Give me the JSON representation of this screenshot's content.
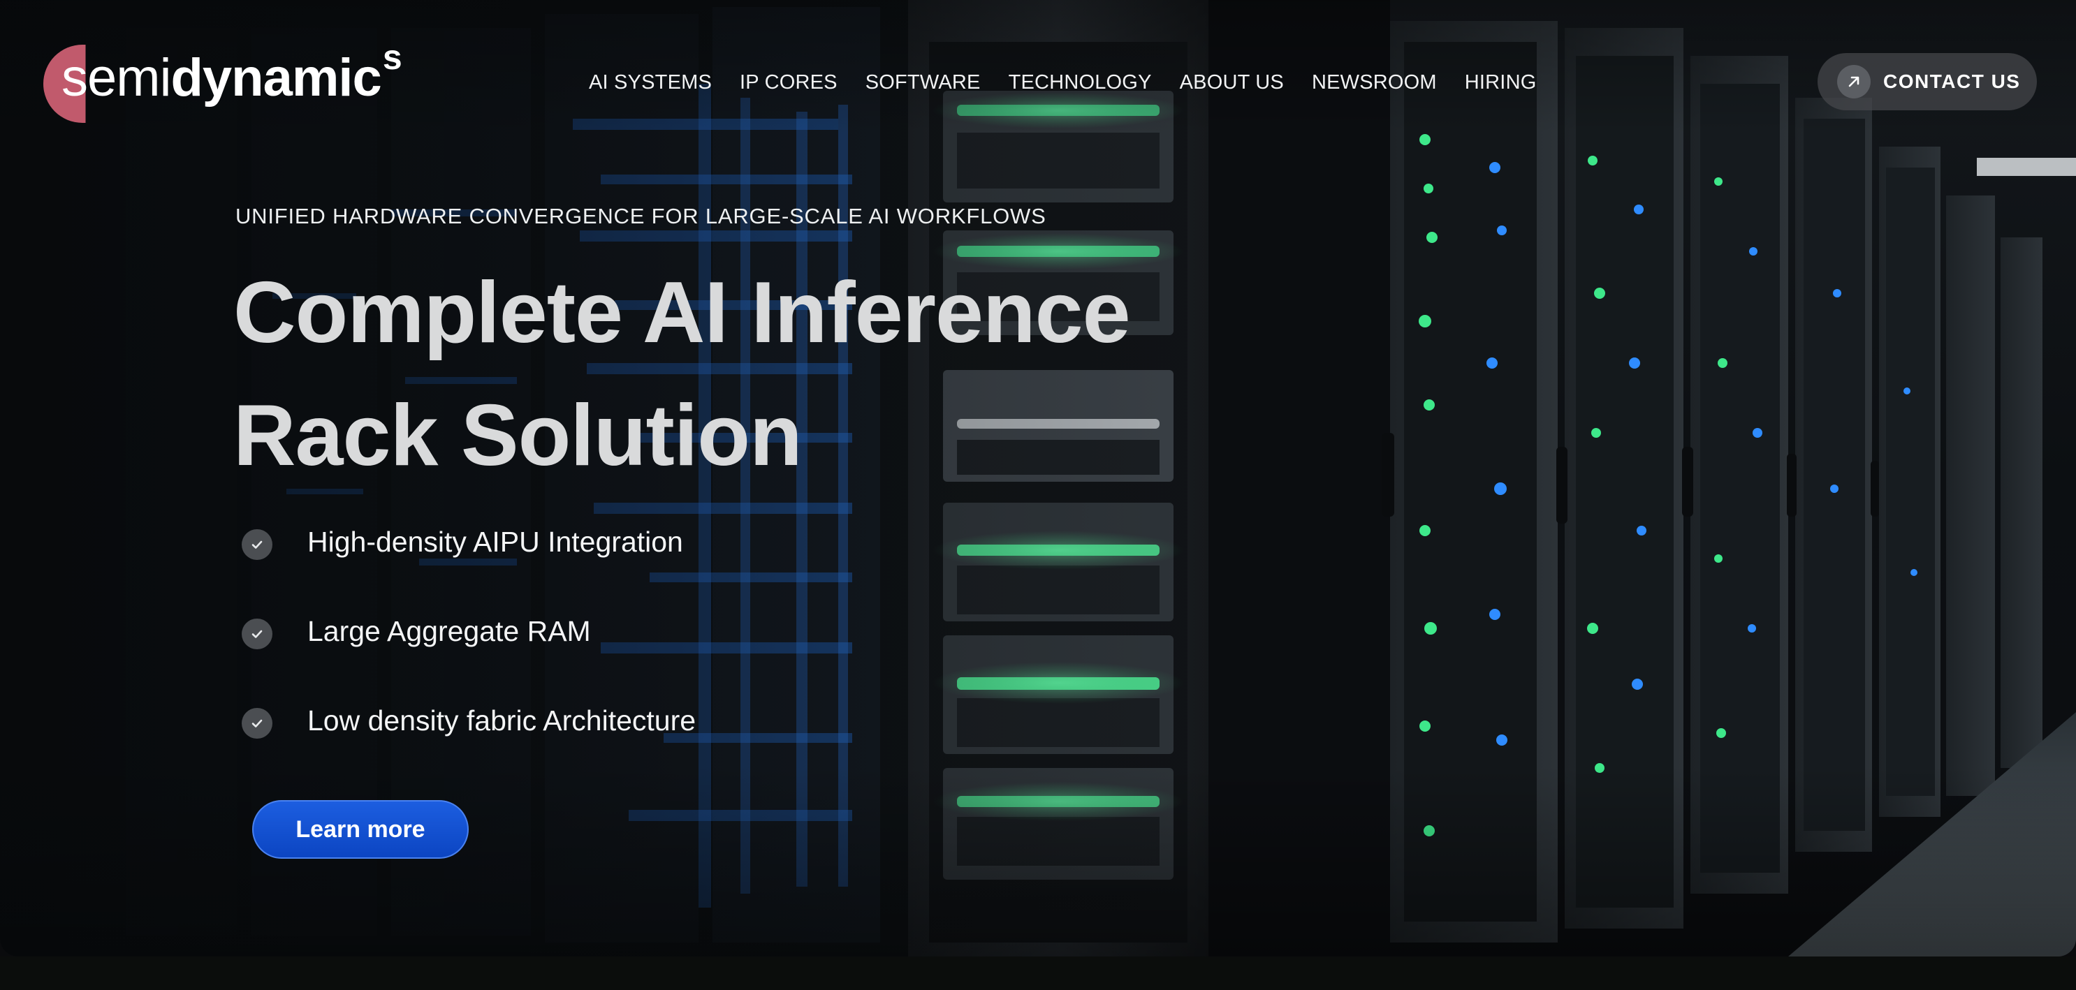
{
  "brand": {
    "name_light": "semi",
    "name_bold": "dynamic",
    "name_super": "s",
    "accent_color": "#c15a6c"
  },
  "nav": {
    "items": [
      {
        "label": "AI SYSTEMS"
      },
      {
        "label": "IP CORES"
      },
      {
        "label": "SOFTWARE"
      },
      {
        "label": "TECHNOLOGY"
      },
      {
        "label": "ABOUT US"
      },
      {
        "label": "NEWSROOM"
      },
      {
        "label": "HIRING"
      }
    ]
  },
  "contact": {
    "label": "CONTACT US",
    "icon": "arrow-up-right-icon"
  },
  "hero": {
    "eyebrow": "UNIFIED HARDWARE CONVERGENCE FOR LARGE-SCALE AI WORKFLOWS",
    "headline_line1": "Complete AI Inference",
    "headline_line2": "Rack Solution",
    "features": [
      {
        "label": "High-density AIPU Integration",
        "icon": "check-icon"
      },
      {
        "label": "Large Aggregate RAM",
        "icon": "check-icon"
      },
      {
        "label": "Low density fabric Architecture",
        "icon": "check-icon"
      }
    ],
    "cta_label": "Learn more",
    "cta_color": "#1556d8"
  }
}
